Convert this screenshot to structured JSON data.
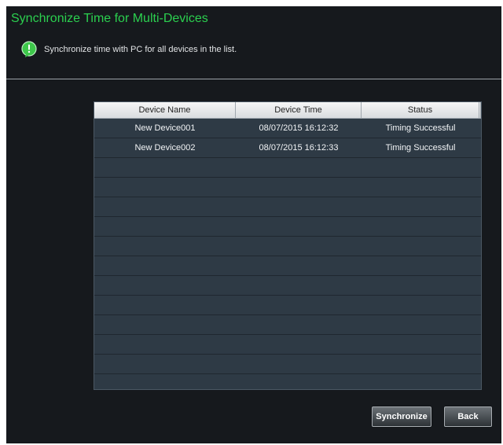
{
  "window": {
    "title": "Synchronize Time for Multi-Devices"
  },
  "info": {
    "icon": "info-bubble-icon",
    "icon_color": "#3ec84b",
    "text": "Synchronize time with PC for all devices in the list."
  },
  "table": {
    "columns": [
      "Device Name",
      "Device Time",
      "Status"
    ],
    "rows": [
      {
        "name": "New Device001",
        "time": "08/07/2015 16:12:32",
        "status": "Timing Successful"
      },
      {
        "name": "New Device002",
        "time": "08/07/2015 16:12:33",
        "status": "Timing Successful"
      }
    ],
    "empty_row_count": 12
  },
  "buttons": {
    "synchronize": "Synchronize",
    "back": "Back"
  },
  "colors": {
    "title": "#2bd04f",
    "background": "#16191d",
    "table_background": "#2e3a45"
  }
}
